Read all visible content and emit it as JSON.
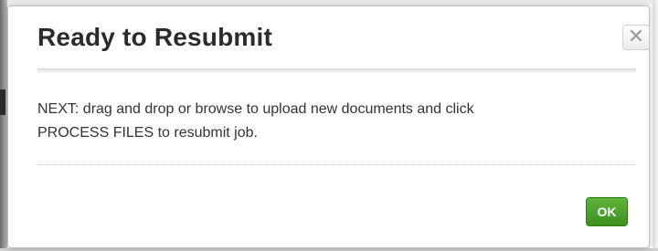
{
  "dialog": {
    "title": "Ready to Resubmit",
    "close_glyph": "✕",
    "close_icon": "close-icon",
    "message_line1": "NEXT: drag and drop or browse to upload new documents and click",
    "message_line2": "PROCESS FILES to resubmit job.",
    "ok_label": "OK"
  },
  "colors": {
    "ok_button": "#4a9e2a",
    "title_text": "#2b2b2b",
    "body_text": "#333333"
  }
}
